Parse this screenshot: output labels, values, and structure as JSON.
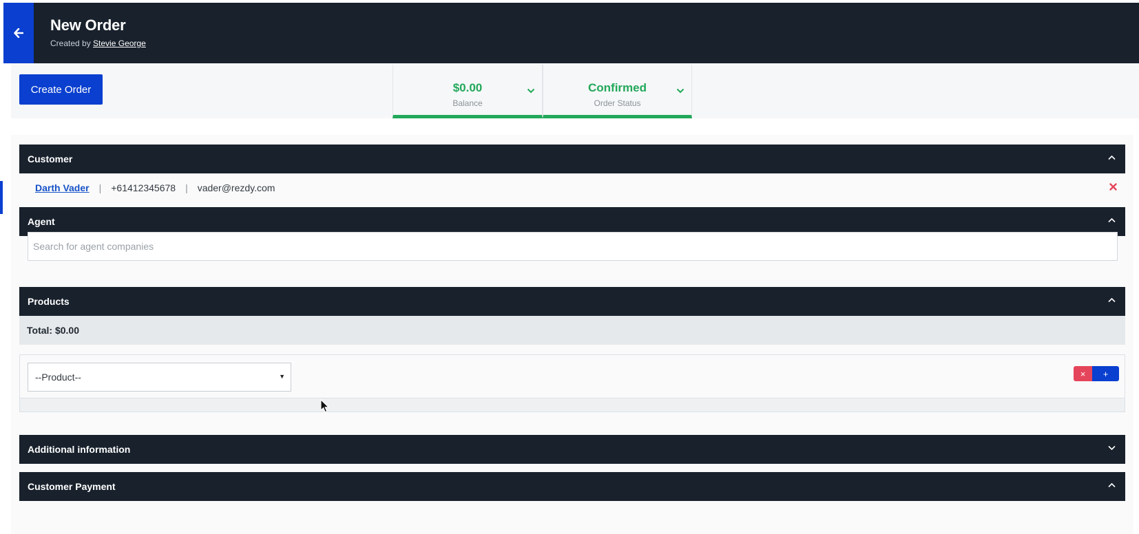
{
  "header": {
    "title": "New Order",
    "created_by_prefix": "Created by",
    "created_by_name": "Stevie George"
  },
  "toolbar": {
    "create_label": "Create Order",
    "balance": {
      "value": "$0.00",
      "label": "Balance"
    },
    "status": {
      "value": "Confirmed",
      "label": "Order Status"
    }
  },
  "customer": {
    "title": "Customer",
    "name": "Darth Vader",
    "separator": "|",
    "phone": "+61412345678",
    "email": "vader@rezdy.com"
  },
  "agent": {
    "title": "Agent",
    "placeholder": "Search for agent companies"
  },
  "products": {
    "title": "Products",
    "total_label": "Total: $0.00",
    "select_value": "--Product--",
    "remove_glyph": "×",
    "add_glyph": "+"
  },
  "additional": {
    "title": "Additional information"
  },
  "payment": {
    "title": "Customer Payment"
  },
  "colors": {
    "accent": "#0a3fcf",
    "dark": "#18212c",
    "success": "#22a85a",
    "danger": "#e5455a"
  },
  "icons": {
    "back": "arrow-left-icon",
    "chevron_down": "chevron-down-icon",
    "chevron_up": "chevron-up-icon",
    "close": "close-icon",
    "cursor": "mouse-pointer-icon"
  }
}
